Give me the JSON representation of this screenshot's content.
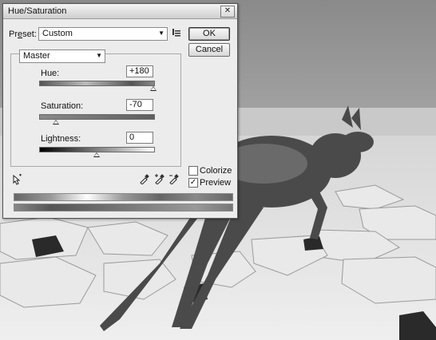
{
  "dialog": {
    "title": "Hue/Saturation",
    "close_glyph": "✕"
  },
  "preset": {
    "label_u": "e",
    "label_pre": "Pr",
    "label_post": "set:",
    "value": "Custom",
    "options_icon": "preset-options-icon"
  },
  "buttons": {
    "ok": "OK",
    "cancel": "Cancel"
  },
  "channel": {
    "value": "Master"
  },
  "hue": {
    "label": "Hue:",
    "value": "+180",
    "slider_fraction": 1.0
  },
  "saturation": {
    "label": "Saturation:",
    "value": "-70",
    "slider_fraction": 0.15
  },
  "lightness": {
    "label": "Lightness:",
    "value": "0",
    "slider_fraction": 0.5
  },
  "options": {
    "colorize_label": "Colorize",
    "colorize_checked": false,
    "preview_label": "Preview",
    "preview_checked": true
  },
  "tools": {
    "targeted_adjustment": "targeted-adjustment-icon",
    "eyedropper": "eyedropper-icon",
    "eyedropper_plus": "eyedropper-plus-icon",
    "eyedropper_minus": "eyedropper-minus-icon"
  }
}
